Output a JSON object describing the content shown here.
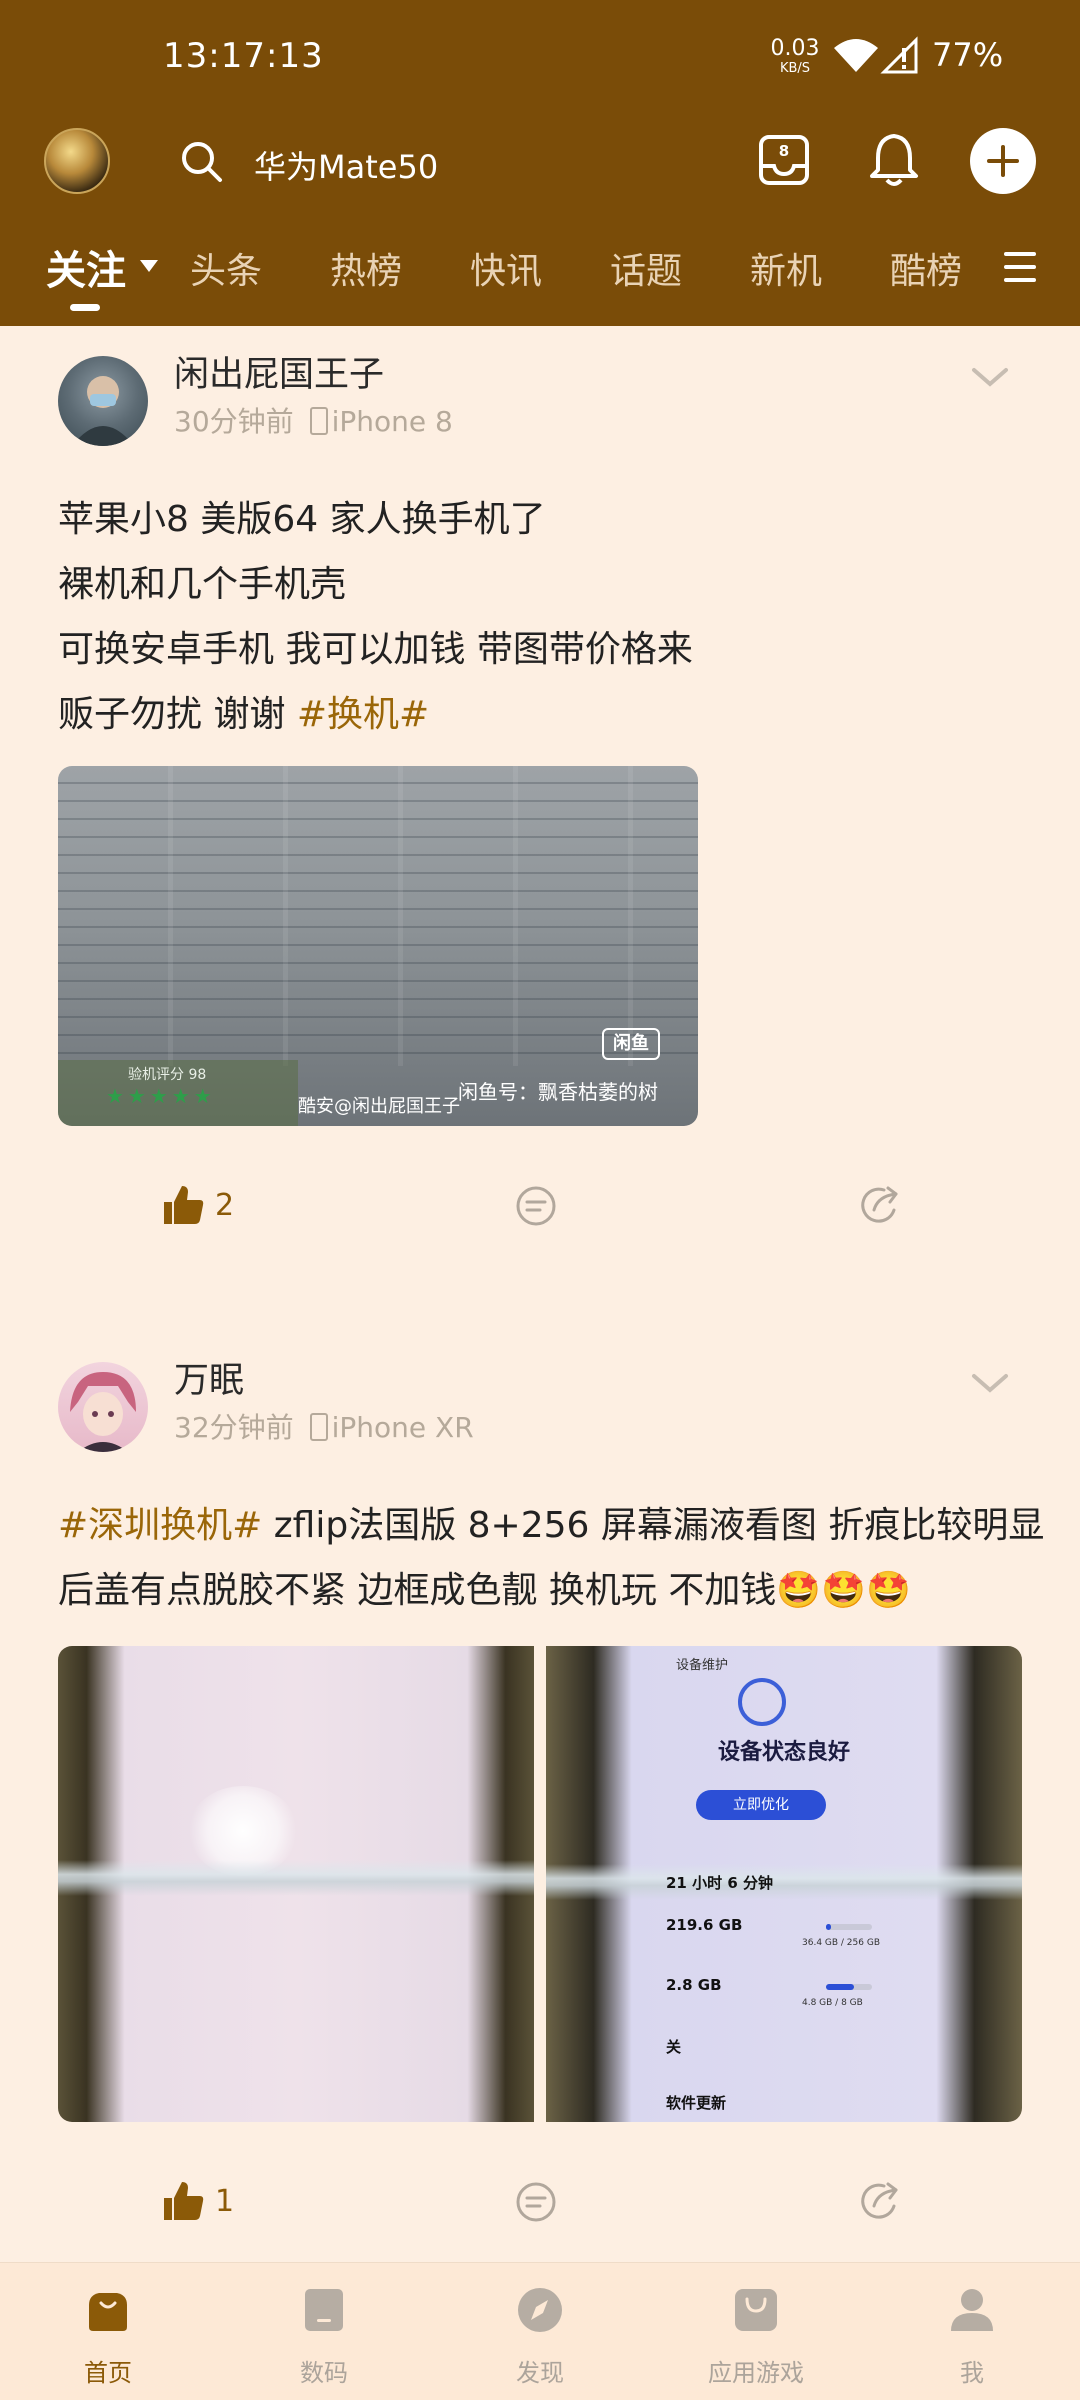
{
  "status_bar": {
    "time": "13:17:13",
    "net_speed": "0.03",
    "net_unit": "KB/S",
    "battery": "77%"
  },
  "header": {
    "search_text": "华为Mate50",
    "message_count": "8"
  },
  "tabs": [
    "关注",
    "头条",
    "热榜",
    "快讯",
    "话题",
    "新机",
    "酷榜"
  ],
  "posts": [
    {
      "author": "闲出屁国王子",
      "time": "30分钟前",
      "device": "iPhone 8",
      "lines": [
        "苹果小8 美版64 家人换手机了",
        "裸机和几个手机壳",
        "可换安卓手机 我可以加钱 带图带价格来",
        "贩子勿扰 谢谢 "
      ],
      "hashtag_end": "#换机#",
      "image": {
        "brand_badge": "闲鱼",
        "watermark": "酷安@闲出屁国王子",
        "xianyu_label": "闲鱼号：飘香枯萎的树",
        "score_text": "验机评分 98"
      },
      "likes": "2"
    },
    {
      "author": "万眠",
      "time": "32分钟前",
      "device": "iPhone XR",
      "hashtag_start": "#深圳换机#",
      "line1_rest": " zflip法国版 8+256 屏幕漏液看图 折痕比较明显",
      "line2": "后盖有点脱胶不紧 边框成色靓 换机玩 不加钱🤩🤩🤩",
      "image_right": {
        "header": "设备维护",
        "title": "设备状态良好",
        "button": "立即优化",
        "stat1_value": "21 小时 6 分钟",
        "stat2_value": "219.6 GB",
        "stat2_total": "36.4 GB / 256 GB",
        "stat3_value": "2.8 GB",
        "stat3_total": "4.8 GB / 8 GB",
        "stat4_value": "关",
        "stat5_value": "软件更新"
      },
      "likes": "1"
    }
  ],
  "bottom_nav": [
    {
      "label": "首页",
      "icon": "home-icon"
    },
    {
      "label": "数码",
      "icon": "digital-icon"
    },
    {
      "label": "发现",
      "icon": "compass-icon"
    },
    {
      "label": "应用游戏",
      "icon": "store-icon"
    },
    {
      "label": "我",
      "icon": "user-icon"
    }
  ],
  "colors": {
    "header_bg": "#7a4c08",
    "page_bg": "#fdefe2",
    "accent": "#8b5a08",
    "hashtag": "#9a6608"
  }
}
